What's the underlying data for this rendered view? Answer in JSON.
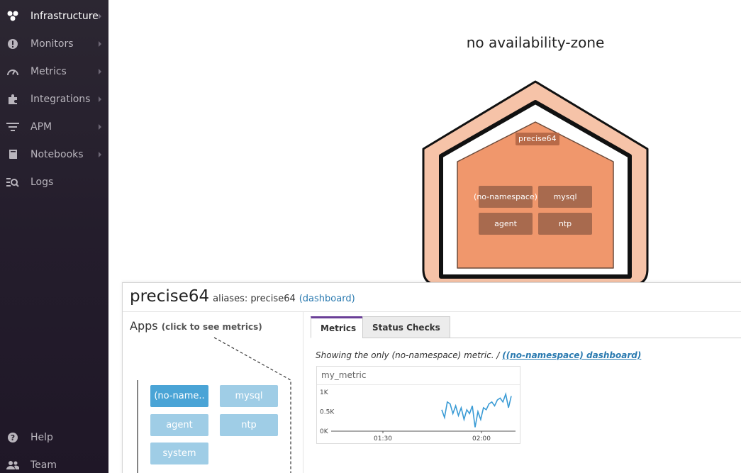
{
  "sidebar": {
    "items": [
      {
        "label": "Infrastructure",
        "icon": "hexagons-icon",
        "active": true,
        "has_arrow": true
      },
      {
        "label": "Monitors",
        "icon": "alert-icon",
        "active": false,
        "has_arrow": true
      },
      {
        "label": "Metrics",
        "icon": "gauge-icon",
        "active": false,
        "has_arrow": true
      },
      {
        "label": "Integrations",
        "icon": "puzzle-icon",
        "active": false,
        "has_arrow": true
      },
      {
        "label": "APM",
        "icon": "apm-icon",
        "active": false,
        "has_arrow": true
      },
      {
        "label": "Notebooks",
        "icon": "notebook-icon",
        "active": false,
        "has_arrow": true
      },
      {
        "label": "Logs",
        "icon": "logs-icon",
        "active": false,
        "has_arrow": false
      }
    ],
    "bottom_items": [
      {
        "label": "Help",
        "icon": "help-icon"
      },
      {
        "label": "Team",
        "icon": "team-icon"
      }
    ]
  },
  "map": {
    "zone_title": "no availability-zone",
    "host_tag": "precise64",
    "tiles": [
      "(no-namespace)",
      "mysql",
      "agent",
      "ntp"
    ],
    "colors": {
      "outer_ring": "#f6c3a8",
      "inner_hex": "#f0976c",
      "tile": "#a86a4e"
    }
  },
  "panel": {
    "host_name": "precise64",
    "aliases_label": "aliases: precise64",
    "dashboard_link": "(dashboard)",
    "apps_title": "Apps",
    "apps_hint": "(click to see metrics)",
    "apps": [
      {
        "label": "(no-name..",
        "selected": true
      },
      {
        "label": "mysql",
        "selected": false
      },
      {
        "label": "agent",
        "selected": false
      },
      {
        "label": "ntp",
        "selected": false
      },
      {
        "label": "system",
        "selected": false
      }
    ],
    "tabs": [
      {
        "label": "Metrics",
        "active": true
      },
      {
        "label": "Status Checks",
        "active": false
      }
    ],
    "note_prefix": "Showing the only (no-namespace) metric. /",
    "note_link": "((no-namespace) dashboard)"
  },
  "chart_data": {
    "type": "line",
    "title": "my_metric",
    "x_ticks": [
      "01:30",
      "02:00"
    ],
    "y_ticks": [
      "1K",
      "0.5K",
      "0K"
    ],
    "ylim": [
      0,
      1000
    ],
    "series": [
      {
        "color": "#3a9bd5",
        "values": [
          0.55,
          0.35,
          0.75,
          0.7,
          0.45,
          0.65,
          0.4,
          0.6,
          0.3,
          0.55,
          0.45,
          0.65,
          0.1,
          0.5,
          0.3,
          0.6,
          0.55,
          0.7,
          0.75,
          0.65,
          0.8,
          0.85,
          0.75,
          0.95,
          0.6,
          0.9
        ]
      }
    ]
  }
}
